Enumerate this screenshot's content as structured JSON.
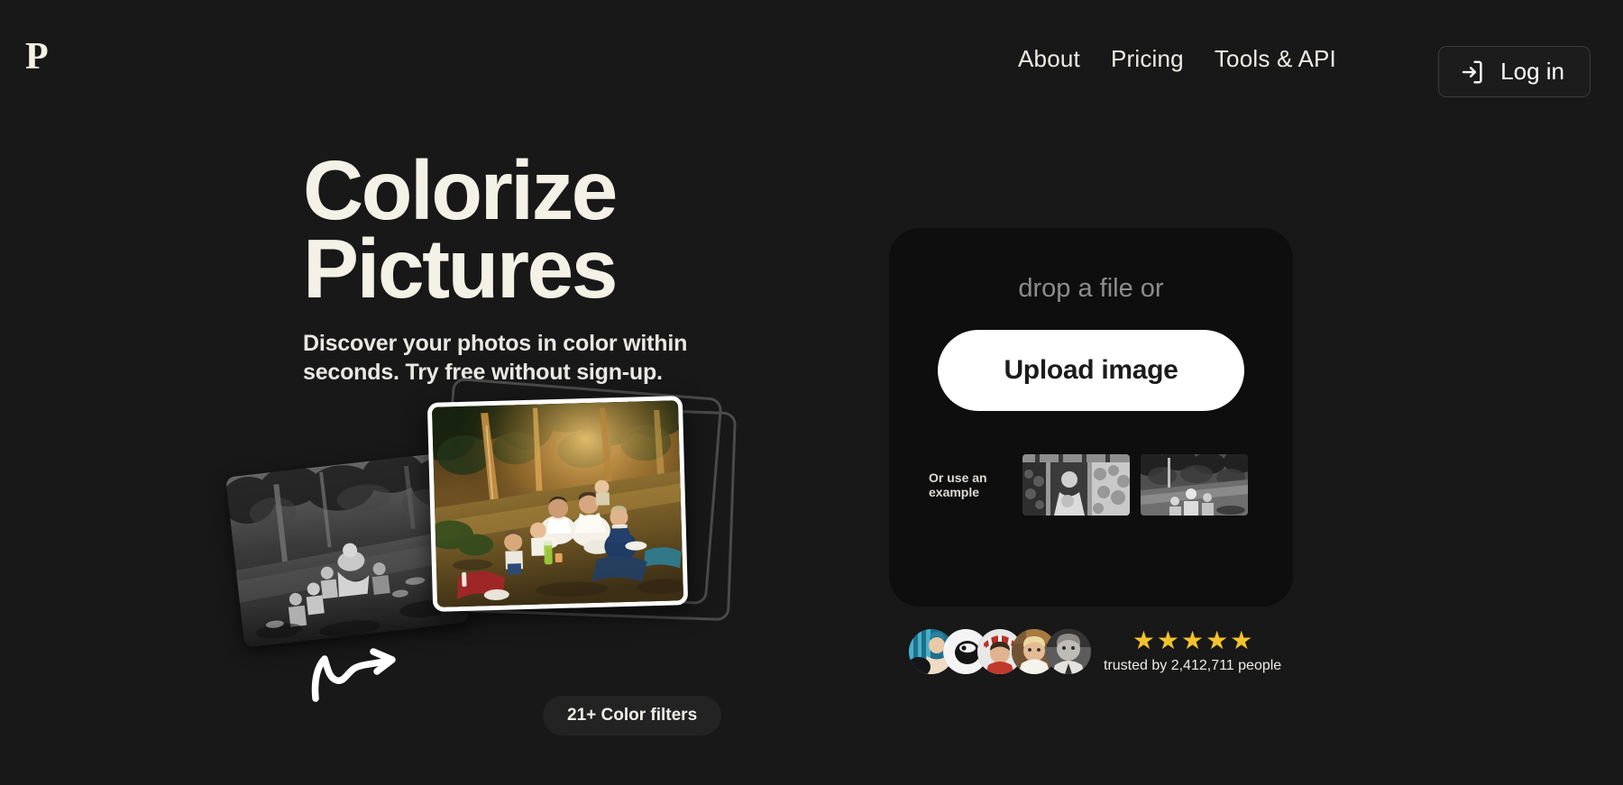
{
  "brand": {
    "logo_letter": "P"
  },
  "nav": {
    "items": [
      {
        "label": "About"
      },
      {
        "label": "Pricing"
      },
      {
        "label": "Tools & API"
      }
    ],
    "login": {
      "label": "Log in",
      "icon": "login-arrow-icon"
    }
  },
  "hero": {
    "title_line1": "Colorize",
    "title_line2": "Pictures",
    "subtitle": "Discover your photos in color within seconds. Try free without sign-up.",
    "filters_badge": "21+ Color filters",
    "arrow_icon": "curved-arrow-icon",
    "before_photo_alt": "black and white family picnic photo",
    "after_photo_alt": "colorized family picnic photo"
  },
  "upload": {
    "drop_text": "drop a file or",
    "button_label": "Upload image",
    "examples_label": "Or use an example",
    "examples": [
      {
        "alt": "example black and white portrait in doorway"
      },
      {
        "alt": "example black and white outdoor family scene"
      }
    ]
  },
  "social_proof": {
    "stars": [
      "★",
      "★",
      "★",
      "★",
      "★"
    ],
    "star_count": 5,
    "trust_text": "trusted by 2,412,711 people",
    "avatar_count": 5
  },
  "colors": {
    "page_background": "#181818",
    "card_background": "#0e0e0e",
    "cream_text": "#f4f1e6",
    "muted_text": "#8c8c8c",
    "star_gold": "#f3c22c",
    "button_white": "#ffffff"
  }
}
